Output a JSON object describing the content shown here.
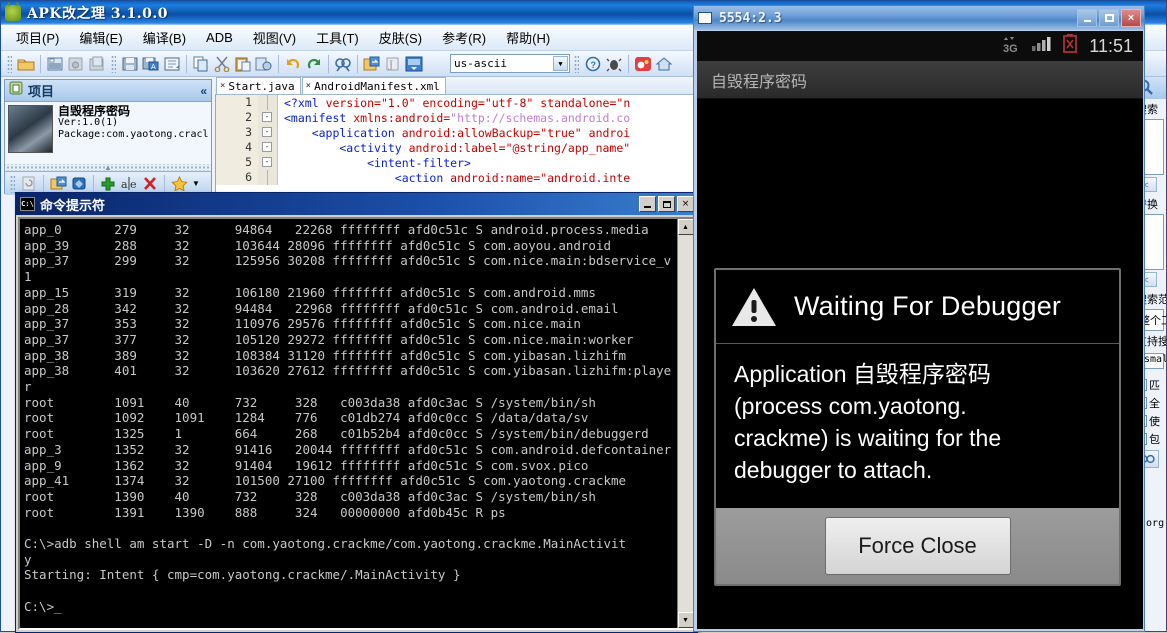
{
  "apk_window": {
    "title": "APK改之理  3.1.0.0",
    "icon": "android-robot-icon",
    "menus": [
      {
        "label": "项目(P)"
      },
      {
        "label": "编辑(E)"
      },
      {
        "label": "编译(B)"
      },
      {
        "label": "ADB"
      },
      {
        "label": "视图(V)"
      },
      {
        "label": "工具(T)"
      },
      {
        "label": "皮肤(S)"
      },
      {
        "label": "参考(R)"
      },
      {
        "label": "帮助(H)"
      }
    ],
    "toolbar": {
      "encoding_value": "us-ascii",
      "icons": [
        "open-folder-icon",
        "new-project-icon",
        "close-project-icon",
        "package-icon",
        "save-icon",
        "save-all-icon",
        "save-as-icon",
        "copy-icon",
        "cut-icon",
        "paste-icon",
        "paste-special-icon",
        "undo-icon",
        "redo-icon",
        "find-icon",
        "replace-icon",
        "sign-icon",
        "install-icon",
        "help-icon",
        "debug-bug-icon",
        "weibo-icon",
        "home-icon"
      ]
    }
  },
  "project_panel": {
    "header_title": "项目",
    "collapse_glyph": "«",
    "app_name": "自毁程序密码",
    "version": "Ver:1.0(1)",
    "package": "Package:com.yaotong.cracl",
    "toolbar_icons": [
      "refresh-icon",
      "open-dir-icon",
      "gem-icon",
      "add-icon",
      "rename-icon",
      "delete-icon",
      "favorite-star-icon",
      "dropdown-arrow-icon"
    ]
  },
  "editor": {
    "tabs": [
      {
        "label": "Start.java",
        "close_glyph": "×",
        "active": false
      },
      {
        "label": "AndroidManifest.xml",
        "close_glyph": "×",
        "active": true
      }
    ],
    "lines": [
      {
        "num": "1",
        "fold": "",
        "segments": [
          {
            "t": "<?",
            "c": "t-br"
          },
          {
            "t": "xml",
            "c": "t-tag"
          },
          {
            "t": " version=",
            "c": "t-attr"
          },
          {
            "t": "\"1.0\"",
            "c": "t-str"
          },
          {
            "t": " encoding=",
            "c": "t-attr"
          },
          {
            "t": "\"utf-8\"",
            "c": "t-str"
          },
          {
            "t": " standalone=",
            "c": "t-attr"
          },
          {
            "t": "\"n",
            "c": "t-str"
          }
        ]
      },
      {
        "num": "2",
        "fold": "-",
        "segments": [
          {
            "t": "<manifest",
            "c": "t-tag"
          },
          {
            "t": " xmlns:android=",
            "c": "t-attr"
          },
          {
            "t": "\"http://schemas.android.co",
            "c": "t-url"
          }
        ]
      },
      {
        "num": "3",
        "fold": "-",
        "segments": [
          {
            "t": "    <application",
            "c": "t-tag"
          },
          {
            "t": " android:allowBackup=",
            "c": "t-attr"
          },
          {
            "t": "\"true\"",
            "c": "t-str"
          },
          {
            "t": " androi",
            "c": "t-attr"
          }
        ]
      },
      {
        "num": "4",
        "fold": "-",
        "segments": [
          {
            "t": "        <activity",
            "c": "t-tag"
          },
          {
            "t": " android:label=",
            "c": "t-attr"
          },
          {
            "t": "\"@string/app_name\"",
            "c": "t-str"
          }
        ]
      },
      {
        "num": "5",
        "fold": "-",
        "segments": [
          {
            "t": "            <intent-filter>",
            "c": "t-tag"
          }
        ]
      },
      {
        "num": "6",
        "fold": "",
        "segments": [
          {
            "t": "                <action",
            "c": "t-tag"
          },
          {
            "t": " android:name=",
            "c": "t-attr"
          },
          {
            "t": "\"android.inte",
            "c": "t-str"
          }
        ]
      }
    ]
  },
  "right_panel": {
    "header_icon": "magnifier-icon",
    "search_label": "搜索",
    "replace_label": "替换",
    "scope_label": "搜索范",
    "scope_value": "整个工",
    "support_label": "支持搜",
    "filter_value": ".smal",
    "checkboxes": [
      {
        "label": "匹",
        "checked": false
      },
      {
        "label": "全",
        "checked": false
      },
      {
        "label": "使",
        "checked": false
      },
      {
        "label": "包",
        "checked": true
      }
    ],
    "find_button_icon": "binoculars-icon",
    "footer_text": "n.org",
    "prev_glyph": "<"
  },
  "cmd_window": {
    "title": "命令提示符",
    "icon_text": "C:\\",
    "buttons": {
      "minimize": "minimize-button",
      "maximize": "maximize-button",
      "close": "×"
    },
    "scrollbar": {
      "up": "▲",
      "down": "▼"
    },
    "lines": [
      "app_0       279     32      94864   22268 ffffffff afd0c51c S android.process.media",
      "app_39      288     32      103644 28096 ffffffff afd0c51c S com.aoyou.android",
      "app_37      299     32      125956 30208 ffffffff afd0c51c S com.nice.main:bdservice_v",
      "1",
      "app_15      319     32      106180 21960 ffffffff afd0c51c S com.android.mms",
      "app_28      342     32      94484   22968 ffffffff afd0c51c S com.android.email",
      "app_37      353     32      110976 29576 ffffffff afd0c51c S com.nice.main",
      "app_37      377     32      105120 29272 ffffffff afd0c51c S com.nice.main:worker",
      "app_38      389     32      108384 31120 ffffffff afd0c51c S com.yibasan.lizhifm",
      "app_38      401     32      103620 27612 ffffffff afd0c51c S com.yibasan.lizhifm:playe",
      "r",
      "root        1091    40      732     328   c003da38 afd0c3ac S /system/bin/sh",
      "root        1092    1091    1284    776   c01db274 afd0c0cc S /data/data/sv",
      "root        1325    1       664     268   c01b52b4 afd0c0cc S /system/bin/debuggerd",
      "app_3       1352    32      91416   20044 ffffffff afd0c51c S com.android.defcontainer",
      "app_9       1362    32      91404   19612 ffffffff afd0c51c S com.svox.pico",
      "app_41      1374    32      101500 27100 ffffffff afd0c51c S com.yaotong.crackme",
      "root        1390    40      732     328   c003da38 afd0c3ac S /system/bin/sh",
      "root        1391    1390    888     324   00000000 afd0b45c R ps",
      "",
      "C:\\>adb shell am start -D -n com.yaotong.crackme/com.yaotong.crackme.MainActivit",
      "y",
      "Starting: Intent { cmp=com.yaotong.crackme/.MainActivity }",
      "",
      "C:\\>_"
    ]
  },
  "emulator": {
    "title": "5554:2.3",
    "buttons": {
      "minimize": "minimize-button",
      "maximize": "maximize-button",
      "close": "×"
    },
    "statusbar": {
      "network_icon": "3g-data-icon",
      "network_label": "3G",
      "signal_icon": "signal-bars-icon",
      "battery_icon": "battery-error-icon",
      "clock": "11:51"
    },
    "app_title": "自毁程序密码",
    "dialog": {
      "icon": "warning-triangle-icon",
      "heading": "Waiting For Debugger",
      "message": "Application 自毁程序密码 (process com.yaotong.crackme) is waiting for the debugger to attach.",
      "message_lines": [
        "Application 自毁程序密码",
        "(process com.yaotong.",
        "crackme) is waiting for the",
        "debugger to attach."
      ],
      "button_label": "Force Close"
    }
  },
  "colors": {
    "title_blue": "#0a4fa8",
    "cmd_bg": "#000000",
    "cmd_fg": "#c8c8c8",
    "xml_tag": "#0b21d6",
    "xml_string": "#c80000",
    "xml_url": "#c07fd0",
    "emulator_close": "#b04b4b"
  }
}
